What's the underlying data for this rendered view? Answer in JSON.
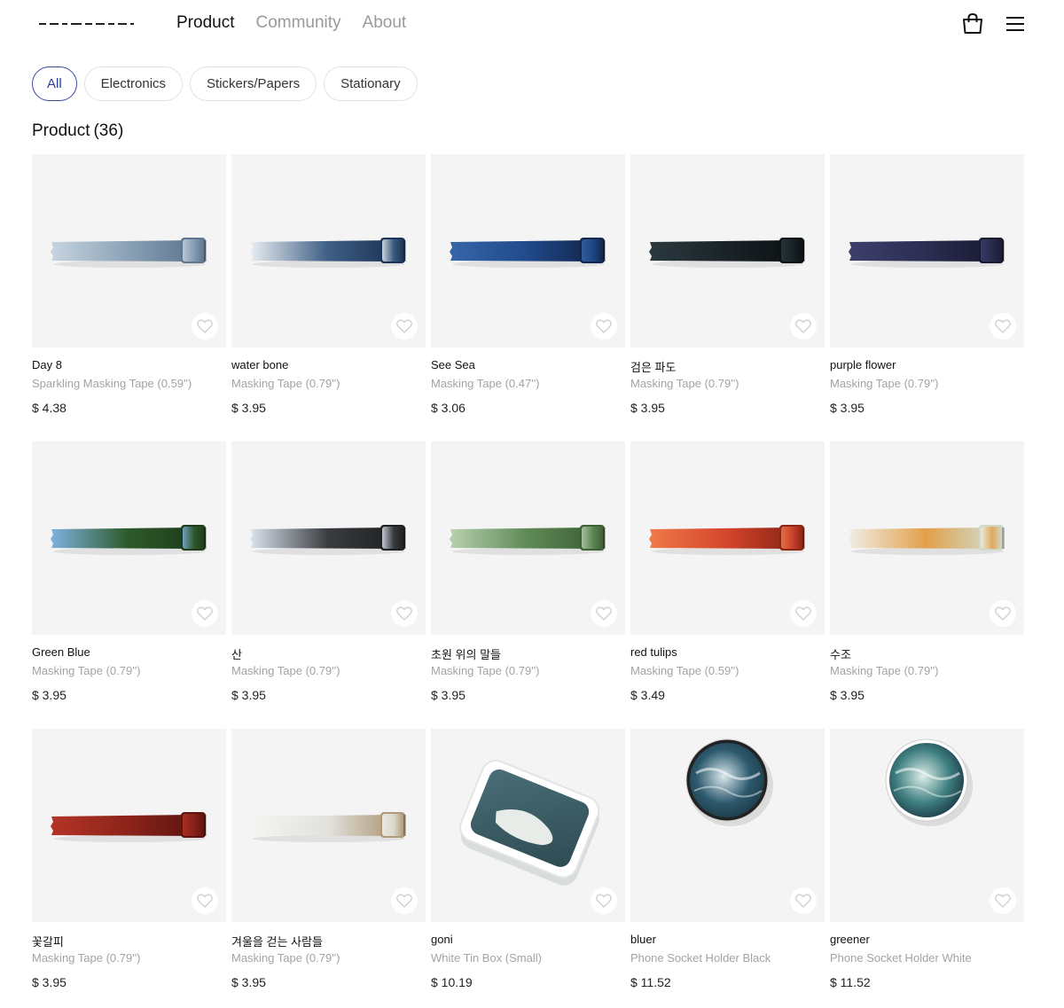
{
  "nav": {
    "items": [
      {
        "label": "Product",
        "active": true
      },
      {
        "label": "Community",
        "active": false
      },
      {
        "label": "About",
        "active": false
      }
    ],
    "cart_icon": "shopping-bag-icon",
    "menu_icon": "hamburger-menu-icon"
  },
  "filters": [
    {
      "label": "All",
      "active": true
    },
    {
      "label": "Electronics",
      "active": false
    },
    {
      "label": "Stickers/Papers",
      "active": false
    },
    {
      "label": "Stationary",
      "active": false
    }
  ],
  "section": {
    "title": "Product",
    "count": "(36)"
  },
  "colors": {
    "accent": "#2d3a9e",
    "muted": "#a3a3a3",
    "thumb_bg": "#f4f4f4"
  },
  "products": [
    {
      "name": "Day 8",
      "subtitle": "Sparkling Masking Tape (0.59'')",
      "price": "$ 4.38",
      "kind": "tape",
      "colors": [
        "#c7d5e0",
        "#8aa1b6",
        "#5e7890"
      ]
    },
    {
      "name": "water bone",
      "subtitle": "Masking Tape (0.79'')",
      "price": "$ 3.95",
      "kind": "tape",
      "colors": [
        "#e9eef2",
        "#3f5f86",
        "#1c3556"
      ]
    },
    {
      "name": "See Sea",
      "subtitle": "Masking Tape (0.47'')",
      "price": "$ 3.06",
      "kind": "tape",
      "colors": [
        "#3766a8",
        "#204a8c",
        "#13264d"
      ]
    },
    {
      "name": "검은 파도",
      "subtitle": "Masking Tape (0.79'')",
      "price": "$ 3.95",
      "kind": "tape",
      "colors": [
        "#2b3a40",
        "#1a2328",
        "#0d1214"
      ]
    },
    {
      "name": "purple flower",
      "subtitle": "Masking Tape (0.79'')",
      "price": "$ 3.95",
      "kind": "tape",
      "colors": [
        "#3c3f6b",
        "#2b2d52",
        "#1a1b33"
      ]
    },
    {
      "name": "Green Blue",
      "subtitle": "Masking Tape (0.79'')",
      "price": "$ 3.95",
      "kind": "tape",
      "colors": [
        "#7fb3e0",
        "#2e5a2a",
        "#1f3d1c"
      ]
    },
    {
      "name": "산",
      "subtitle": "Masking Tape (0.79'')",
      "price": "$ 3.95",
      "kind": "tape",
      "colors": [
        "#dbe4ee",
        "#3a3d40",
        "#1f2123"
      ]
    },
    {
      "name": "초원 위의 말들",
      "subtitle": "Masking Tape (0.79'')",
      "price": "$ 3.95",
      "kind": "tape",
      "colors": [
        "#b8d1b0",
        "#5f8a57",
        "#3e6137"
      ]
    },
    {
      "name": "red tulips",
      "subtitle": "Masking Tape (0.59'')",
      "price": "$ 3.49",
      "kind": "tape",
      "colors": [
        "#f07a4a",
        "#d5452b",
        "#8c2616"
      ]
    },
    {
      "name": "수조",
      "subtitle": "Masking Tape (0.79'')",
      "price": "$ 3.95",
      "kind": "tape",
      "colors": [
        "#efeee6",
        "#e3a04a",
        "#cfd9c6"
      ]
    },
    {
      "name": "꽃갈피",
      "subtitle": "Masking Tape (0.79'')",
      "price": "$ 3.95",
      "kind": "tape",
      "colors": [
        "#b43426",
        "#8c231a",
        "#5e150f"
      ]
    },
    {
      "name": "겨울을 걷는 사람들",
      "subtitle": "Masking Tape (0.79'')",
      "price": "$ 3.95",
      "kind": "tape",
      "colors": [
        "#f4f4f2",
        "#e2e2dd",
        "#b09a7a"
      ]
    },
    {
      "name": "goni",
      "subtitle": "White Tin Box (Small)",
      "price": "$ 10.19",
      "kind": "tin",
      "colors": [
        "#ffffff",
        "#4a6f78",
        "#e8ece9"
      ]
    },
    {
      "name": "bluer",
      "subtitle": "Phone Socket Holder Black",
      "price": "$ 11.52",
      "kind": "socket",
      "colors": [
        "#222222",
        "#2d5a6e",
        "#d9e8ec"
      ]
    },
    {
      "name": "greener",
      "subtitle": "Phone Socket Holder White",
      "price": "$ 11.52",
      "kind": "socket",
      "colors": [
        "#ffffff",
        "#3f7f80",
        "#dceee9"
      ]
    }
  ]
}
